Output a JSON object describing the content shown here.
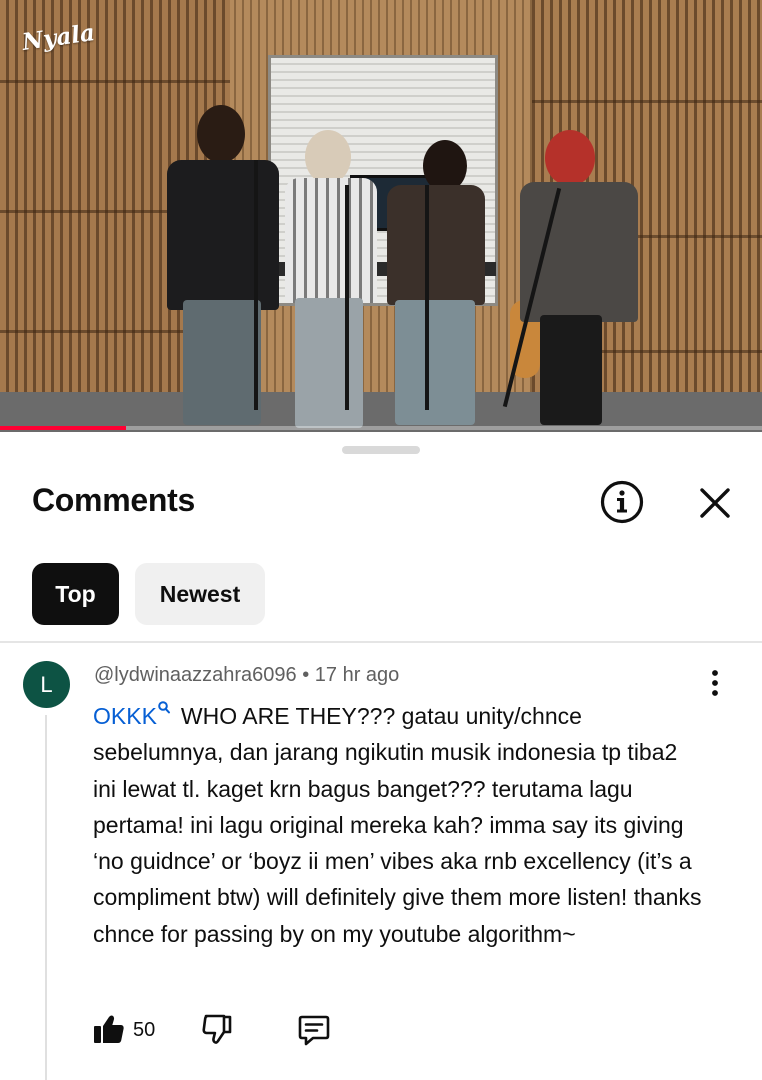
{
  "video": {
    "channel_logo": "Nyala",
    "progress_fraction": 0.165,
    "accent_color": "#ff0033"
  },
  "comments_panel": {
    "title": "Comments",
    "info_icon": "info-circle-icon",
    "close_icon": "close-icon",
    "sort_tabs": [
      {
        "label": "Top",
        "selected": true
      },
      {
        "label": "Newest",
        "selected": false
      }
    ],
    "comment": {
      "avatar_letter": "L",
      "avatar_color": "#0d5344",
      "username": "@lydwinaazzahra6096",
      "separator": " • ",
      "time": "17 hr ago",
      "referenced_text": "OKKK",
      "text": "WHO ARE THEY??? gatau unity/chnce sebelumnya, dan jarang ngikutin musik indonesia tp tiba2 ini lewat tl. kaget krn bagus banget??? terutama lagu pertama! ini lagu original mereka kah? imma say its giving ‘no guidnce’ or ‘boyz ii men’ vibes aka rnb excellency (it’s a compliment btw) will definitely give them more listen! thanks chnce for passing by on my youtube algorithm~",
      "like_count": "50",
      "link_color": "#065fd4"
    }
  }
}
